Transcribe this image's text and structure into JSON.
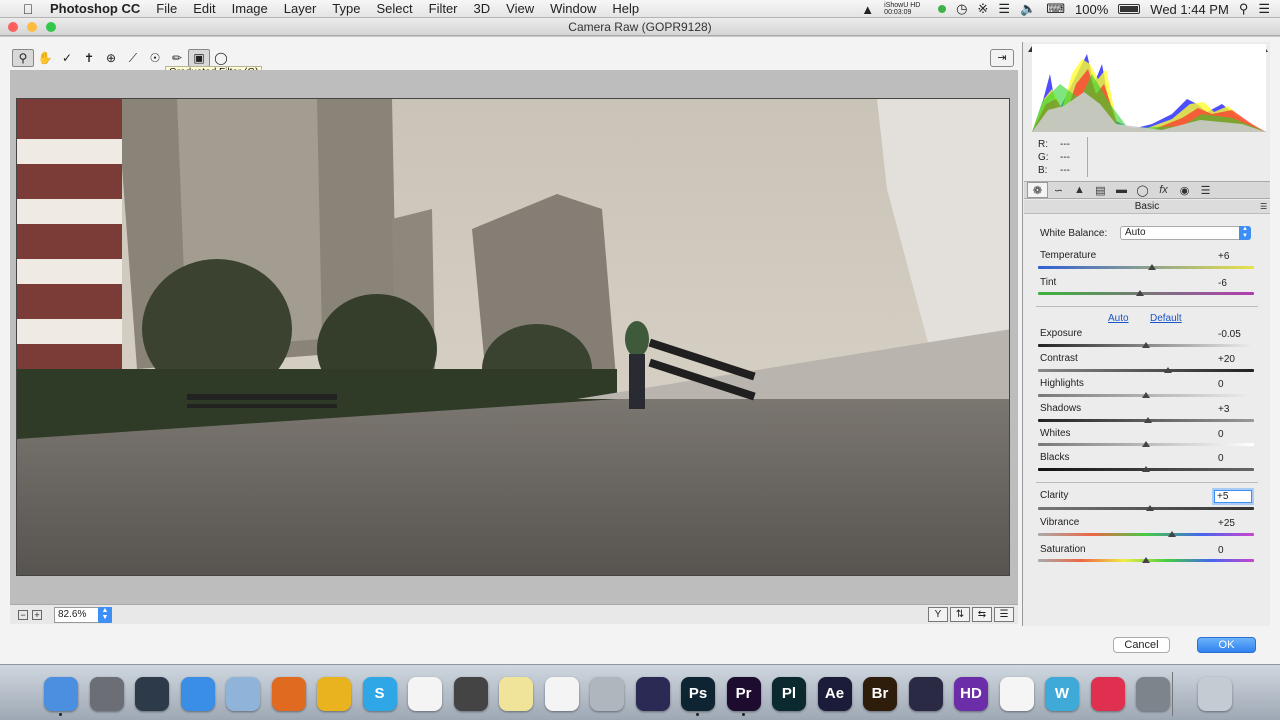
{
  "menubar": {
    "apple_icon": "apple-icon",
    "app_name": "Photoshop CC",
    "items": [
      "File",
      "Edit",
      "Image",
      "Layer",
      "Type",
      "Select",
      "Filter",
      "3D",
      "View",
      "Window",
      "Help"
    ],
    "ishowu_name": "iShowU HD",
    "ishowu_time": "00:03:09",
    "battery_percent": "100%",
    "clock": "Wed 1:44 PM"
  },
  "window": {
    "title": "Camera Raw (GOPR9128)"
  },
  "toolbar": {
    "tools": [
      "zoom-tool-icon",
      "hand-tool-icon",
      "white-balance-tool-icon",
      "color-sampler-tool-icon",
      "target-adjustment-tool-icon",
      "straighten-tool-icon",
      "red-eye-tool-icon",
      "adjustment-brush-icon",
      "graduated-filter-icon",
      "radial-filter-icon"
    ],
    "active_tool": "graduated-filter-icon",
    "tooltip": "Graduated Filter (G)"
  },
  "histogram": {
    "r_label": "R:",
    "r_value": "---",
    "g_label": "G:",
    "g_value": "---",
    "b_label": "B:",
    "b_value": "---"
  },
  "panel_tabs": [
    "basic-tab-icon",
    "tone-curve-tab-icon",
    "detail-tab-icon",
    "hsl-tab-icon",
    "split-toning-tab-icon",
    "lens-corrections-tab-icon",
    "effects-tab-icon",
    "camera-calibration-tab-icon",
    "presets-tab-icon"
  ],
  "basic": {
    "section_title": "Basic",
    "white_balance_label": "White Balance:",
    "white_balance_value": "Auto",
    "auto_link": "Auto",
    "default_link": "Default",
    "sliders": [
      {
        "label": "Temperature",
        "value": "+6",
        "pos": 0.53
      },
      {
        "label": "Tint",
        "value": "-6",
        "pos": 0.47
      },
      {
        "label": "Exposure",
        "value": "-0.05",
        "pos": 0.5
      },
      {
        "label": "Contrast",
        "value": "+20",
        "pos": 0.6
      },
      {
        "label": "Highlights",
        "value": "0",
        "pos": 0.5
      },
      {
        "label": "Shadows",
        "value": "+3",
        "pos": 0.51
      },
      {
        "label": "Whites",
        "value": "0",
        "pos": 0.5
      },
      {
        "label": "Blacks",
        "value": "0",
        "pos": 0.5
      },
      {
        "label": "Clarity",
        "value": "+5",
        "pos": 0.52
      },
      {
        "label": "Vibrance",
        "value": "+25",
        "pos": 0.62
      },
      {
        "label": "Saturation",
        "value": "0",
        "pos": 0.5
      }
    ]
  },
  "statusbar": {
    "zoom": "82.6%"
  },
  "buttons": {
    "cancel": "Cancel",
    "ok": "OK"
  },
  "dock": {
    "apps": [
      {
        "name": "finder-icon",
        "color": "#4a8fe0",
        "text": ""
      },
      {
        "name": "launchpad-icon",
        "color": "#6b6e75",
        "text": ""
      },
      {
        "name": "mission-control-icon",
        "color": "#2d3a4a",
        "text": ""
      },
      {
        "name": "safari-icon",
        "color": "#3b8ee6",
        "text": ""
      },
      {
        "name": "dropbox-icon",
        "color": "#8fb3d9",
        "text": ""
      },
      {
        "name": "firefox-icon",
        "color": "#e06a1f",
        "text": ""
      },
      {
        "name": "chrome-icon",
        "color": "#e9b21f",
        "text": ""
      },
      {
        "name": "skype-icon",
        "color": "#2fa6e6",
        "text": "S"
      },
      {
        "name": "calendar-icon",
        "color": "#f4f4f4",
        "text": ""
      },
      {
        "name": "final-cut-icon",
        "color": "#444",
        "text": ""
      },
      {
        "name": "stickies-icon",
        "color": "#f0e39a",
        "text": ""
      },
      {
        "name": "reminders-icon",
        "color": "#f4f4f4",
        "text": ""
      },
      {
        "name": "help-icon",
        "color": "#b0b6be",
        "text": ""
      },
      {
        "name": "astro-icon",
        "color": "#2a2a55",
        "text": ""
      },
      {
        "name": "photoshop-icon",
        "color": "#0e2433",
        "text": "Ps"
      },
      {
        "name": "premiere-icon",
        "color": "#1d0c2f",
        "text": "Pr"
      },
      {
        "name": "prelude-icon",
        "color": "#0b2a2f",
        "text": "Pl"
      },
      {
        "name": "after-effects-icon",
        "color": "#1b1b3a",
        "text": "Ae"
      },
      {
        "name": "bridge-icon",
        "color": "#2f1d0c",
        "text": "Br"
      },
      {
        "name": "media-encoder-icon",
        "color": "#2a2a44",
        "text": ""
      },
      {
        "name": "hd-video-icon",
        "color": "#6b2ea8",
        "text": "HD"
      },
      {
        "name": "photos-icon",
        "color": "#f5f5f5",
        "text": ""
      },
      {
        "name": "w-app-icon",
        "color": "#3fa9d8",
        "text": "W"
      },
      {
        "name": "itunes-icon",
        "color": "#e0304f",
        "text": ""
      },
      {
        "name": "system-preferences-icon",
        "color": "#7d848c",
        "text": ""
      },
      {
        "name": "trash-icon",
        "color": "#c5cbd2",
        "text": ""
      }
    ]
  }
}
